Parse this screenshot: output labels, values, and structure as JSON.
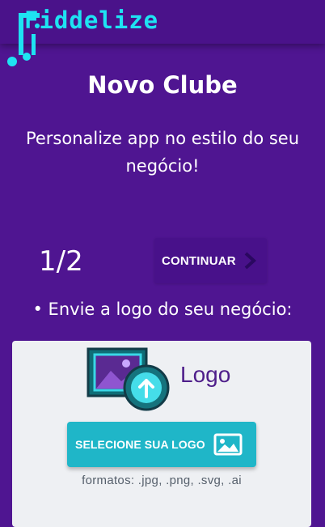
{
  "header": {
    "logo_text": "Fiddelize"
  },
  "page": {
    "title": "Novo Clube",
    "subtitle": "Personalize app no estilo do seu negócio!"
  },
  "progress": {
    "step_label": "1/2",
    "continue_label": "CONTINUAR"
  },
  "instruction": "• Envie a logo do seu negócio:",
  "upload": {
    "title": "Logo",
    "button_label": "SELECIONE SUA LOGO",
    "formats_text": "formatos: .jpg, .png, .svg, .ai",
    "icons": [
      "image-upload-icon",
      "image-icon",
      "chevron-right-icon"
    ]
  },
  "colors": {
    "background": "#4f1591",
    "header": "#4a128a",
    "brand_cyan": "#1ee3f2",
    "button_teal": "#1fb6c8",
    "card": "#eef0f3"
  }
}
